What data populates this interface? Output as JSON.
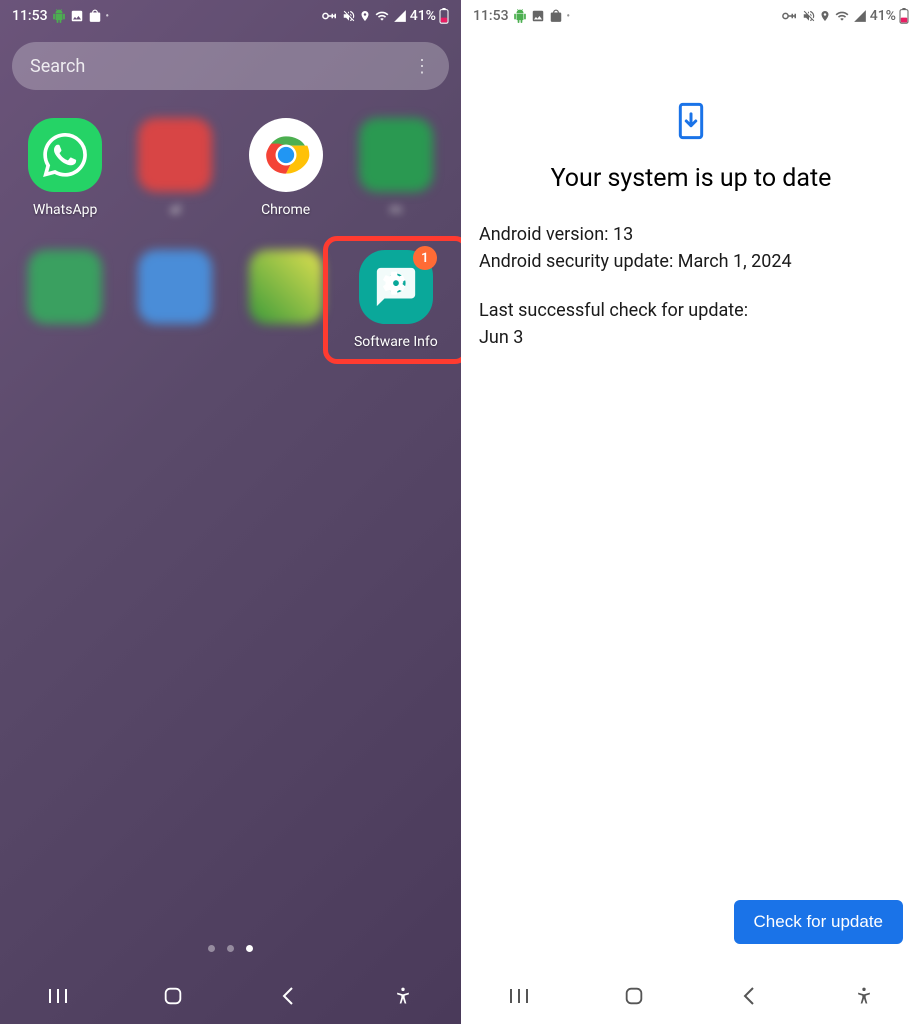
{
  "status": {
    "time": "11:53",
    "battery": "41%"
  },
  "left": {
    "search_placeholder": "Search",
    "apps": {
      "whatsapp": "WhatsApp",
      "blur1": "           al",
      "chrome": "Chrome",
      "blur2": "m                ",
      "software_info": "Software Info",
      "software_badge": "1"
    }
  },
  "right": {
    "title": "Your system is up to date",
    "android_version_label": "Android version: ",
    "android_version_value": "13",
    "security_update_label": "Android security update: ",
    "security_update_value": "March 1, 2024",
    "last_check_label": "Last successful check for update:",
    "last_check_value": "Jun 3",
    "check_button": "Check for update"
  }
}
